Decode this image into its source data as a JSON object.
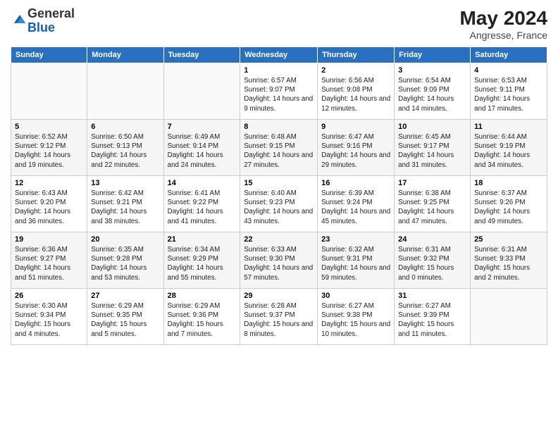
{
  "logo": {
    "general": "General",
    "blue": "Blue"
  },
  "title": {
    "month_year": "May 2024",
    "location": "Angresse, France"
  },
  "days_of_week": [
    "Sunday",
    "Monday",
    "Tuesday",
    "Wednesday",
    "Thursday",
    "Friday",
    "Saturday"
  ],
  "weeks": [
    [
      {
        "day": "",
        "sunrise": "",
        "sunset": "",
        "daylight": ""
      },
      {
        "day": "",
        "sunrise": "",
        "sunset": "",
        "daylight": ""
      },
      {
        "day": "",
        "sunrise": "",
        "sunset": "",
        "daylight": ""
      },
      {
        "day": "1",
        "sunrise": "Sunrise: 6:57 AM",
        "sunset": "Sunset: 9:07 PM",
        "daylight": "Daylight: 14 hours and 9 minutes."
      },
      {
        "day": "2",
        "sunrise": "Sunrise: 6:56 AM",
        "sunset": "Sunset: 9:08 PM",
        "daylight": "Daylight: 14 hours and 12 minutes."
      },
      {
        "day": "3",
        "sunrise": "Sunrise: 6:54 AM",
        "sunset": "Sunset: 9:09 PM",
        "daylight": "Daylight: 14 hours and 14 minutes."
      },
      {
        "day": "4",
        "sunrise": "Sunrise: 6:53 AM",
        "sunset": "Sunset: 9:11 PM",
        "daylight": "Daylight: 14 hours and 17 minutes."
      }
    ],
    [
      {
        "day": "5",
        "sunrise": "Sunrise: 6:52 AM",
        "sunset": "Sunset: 9:12 PM",
        "daylight": "Daylight: 14 hours and 19 minutes."
      },
      {
        "day": "6",
        "sunrise": "Sunrise: 6:50 AM",
        "sunset": "Sunset: 9:13 PM",
        "daylight": "Daylight: 14 hours and 22 minutes."
      },
      {
        "day": "7",
        "sunrise": "Sunrise: 6:49 AM",
        "sunset": "Sunset: 9:14 PM",
        "daylight": "Daylight: 14 hours and 24 minutes."
      },
      {
        "day": "8",
        "sunrise": "Sunrise: 6:48 AM",
        "sunset": "Sunset: 9:15 PM",
        "daylight": "Daylight: 14 hours and 27 minutes."
      },
      {
        "day": "9",
        "sunrise": "Sunrise: 6:47 AM",
        "sunset": "Sunset: 9:16 PM",
        "daylight": "Daylight: 14 hours and 29 minutes."
      },
      {
        "day": "10",
        "sunrise": "Sunrise: 6:45 AM",
        "sunset": "Sunset: 9:17 PM",
        "daylight": "Daylight: 14 hours and 31 minutes."
      },
      {
        "day": "11",
        "sunrise": "Sunrise: 6:44 AM",
        "sunset": "Sunset: 9:19 PM",
        "daylight": "Daylight: 14 hours and 34 minutes."
      }
    ],
    [
      {
        "day": "12",
        "sunrise": "Sunrise: 6:43 AM",
        "sunset": "Sunset: 9:20 PM",
        "daylight": "Daylight: 14 hours and 36 minutes."
      },
      {
        "day": "13",
        "sunrise": "Sunrise: 6:42 AM",
        "sunset": "Sunset: 9:21 PM",
        "daylight": "Daylight: 14 hours and 38 minutes."
      },
      {
        "day": "14",
        "sunrise": "Sunrise: 6:41 AM",
        "sunset": "Sunset: 9:22 PM",
        "daylight": "Daylight: 14 hours and 41 minutes."
      },
      {
        "day": "15",
        "sunrise": "Sunrise: 6:40 AM",
        "sunset": "Sunset: 9:23 PM",
        "daylight": "Daylight: 14 hours and 43 minutes."
      },
      {
        "day": "16",
        "sunrise": "Sunrise: 6:39 AM",
        "sunset": "Sunset: 9:24 PM",
        "daylight": "Daylight: 14 hours and 45 minutes."
      },
      {
        "day": "17",
        "sunrise": "Sunrise: 6:38 AM",
        "sunset": "Sunset: 9:25 PM",
        "daylight": "Daylight: 14 hours and 47 minutes."
      },
      {
        "day": "18",
        "sunrise": "Sunrise: 6:37 AM",
        "sunset": "Sunset: 9:26 PM",
        "daylight": "Daylight: 14 hours and 49 minutes."
      }
    ],
    [
      {
        "day": "19",
        "sunrise": "Sunrise: 6:36 AM",
        "sunset": "Sunset: 9:27 PM",
        "daylight": "Daylight: 14 hours and 51 minutes."
      },
      {
        "day": "20",
        "sunrise": "Sunrise: 6:35 AM",
        "sunset": "Sunset: 9:28 PM",
        "daylight": "Daylight: 14 hours and 53 minutes."
      },
      {
        "day": "21",
        "sunrise": "Sunrise: 6:34 AM",
        "sunset": "Sunset: 9:29 PM",
        "daylight": "Daylight: 14 hours and 55 minutes."
      },
      {
        "day": "22",
        "sunrise": "Sunrise: 6:33 AM",
        "sunset": "Sunset: 9:30 PM",
        "daylight": "Daylight: 14 hours and 57 minutes."
      },
      {
        "day": "23",
        "sunrise": "Sunrise: 6:32 AM",
        "sunset": "Sunset: 9:31 PM",
        "daylight": "Daylight: 14 hours and 59 minutes."
      },
      {
        "day": "24",
        "sunrise": "Sunrise: 6:31 AM",
        "sunset": "Sunset: 9:32 PM",
        "daylight": "Daylight: 15 hours and 0 minutes."
      },
      {
        "day": "25",
        "sunrise": "Sunrise: 6:31 AM",
        "sunset": "Sunset: 9:33 PM",
        "daylight": "Daylight: 15 hours and 2 minutes."
      }
    ],
    [
      {
        "day": "26",
        "sunrise": "Sunrise: 6:30 AM",
        "sunset": "Sunset: 9:34 PM",
        "daylight": "Daylight: 15 hours and 4 minutes."
      },
      {
        "day": "27",
        "sunrise": "Sunrise: 6:29 AM",
        "sunset": "Sunset: 9:35 PM",
        "daylight": "Daylight: 15 hours and 5 minutes."
      },
      {
        "day": "28",
        "sunrise": "Sunrise: 6:29 AM",
        "sunset": "Sunset: 9:36 PM",
        "daylight": "Daylight: 15 hours and 7 minutes."
      },
      {
        "day": "29",
        "sunrise": "Sunrise: 6:28 AM",
        "sunset": "Sunset: 9:37 PM",
        "daylight": "Daylight: 15 hours and 8 minutes."
      },
      {
        "day": "30",
        "sunrise": "Sunrise: 6:27 AM",
        "sunset": "Sunset: 9:38 PM",
        "daylight": "Daylight: 15 hours and 10 minutes."
      },
      {
        "day": "31",
        "sunrise": "Sunrise: 6:27 AM",
        "sunset": "Sunset: 9:39 PM",
        "daylight": "Daylight: 15 hours and 11 minutes."
      },
      {
        "day": "",
        "sunrise": "",
        "sunset": "",
        "daylight": ""
      }
    ]
  ]
}
